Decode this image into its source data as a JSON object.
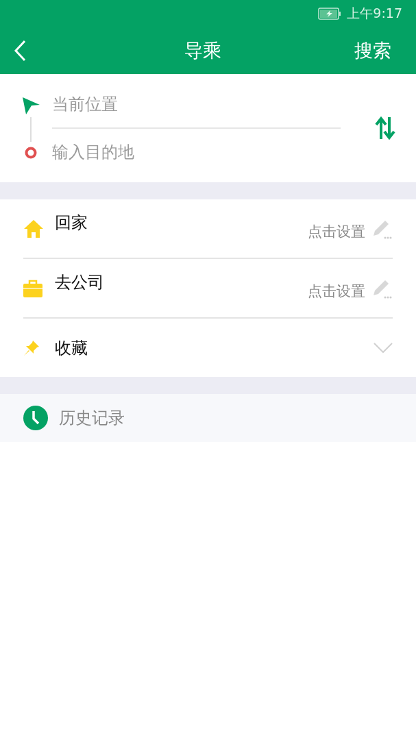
{
  "status_bar": {
    "time": "上午9:17"
  },
  "header": {
    "title": "导乘",
    "action": "搜索"
  },
  "route": {
    "origin": {
      "placeholder": "当前位置"
    },
    "destination": {
      "placeholder": "输入目的地"
    }
  },
  "places": [
    {
      "kind": "home",
      "label": "回家",
      "action": "点击设置"
    },
    {
      "kind": "work",
      "label": "去公司",
      "action": "点击设置"
    },
    {
      "kind": "favorites",
      "label": "收藏",
      "expanded": false
    }
  ],
  "history": {
    "label": "历史记录"
  }
}
